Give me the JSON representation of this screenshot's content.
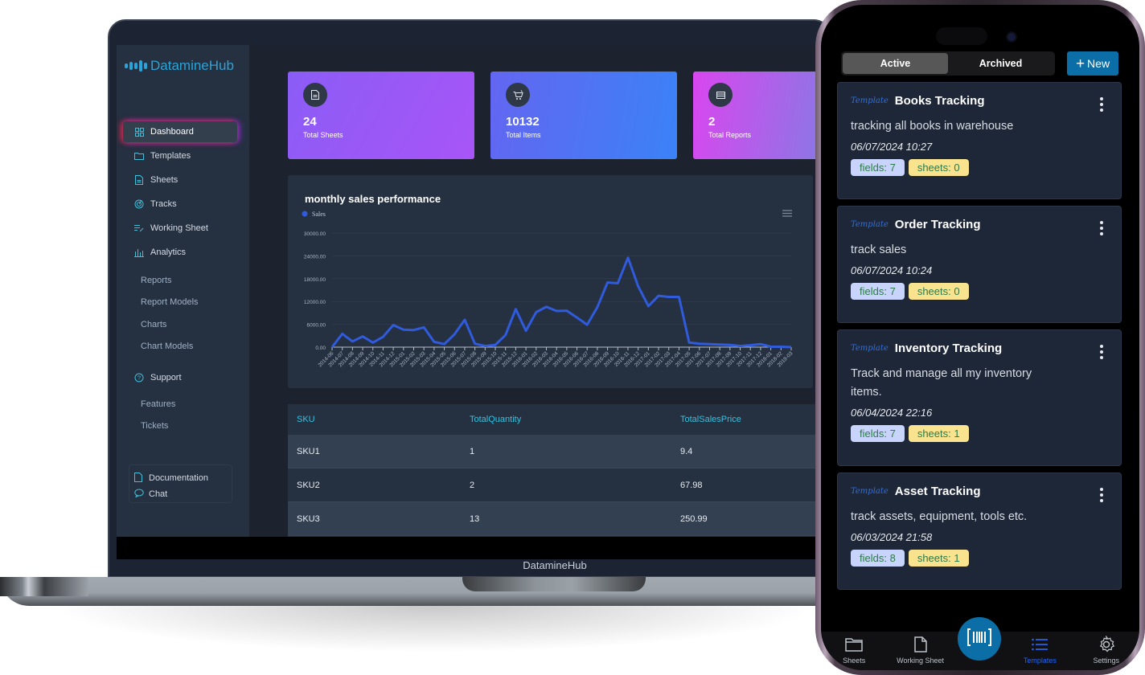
{
  "laptop": {
    "brand_label": "DatamineHub",
    "sidebar": {
      "logo_text": "DatamineHub",
      "nav": [
        {
          "label": "Dashboard",
          "icon": "grid-icon",
          "active": true
        },
        {
          "label": "Templates",
          "icon": "folder-icon"
        },
        {
          "label": "Sheets",
          "icon": "file-icon"
        },
        {
          "label": "Tracks",
          "icon": "radar-icon"
        },
        {
          "label": "Working Sheet",
          "icon": "list-edit-icon"
        },
        {
          "label": "Analytics",
          "icon": "bar-chart-icon"
        }
      ],
      "analytics_sub": [
        "Reports",
        "Report Models",
        "Charts",
        "Chart Models"
      ],
      "support": {
        "label": "Support",
        "icon": "help-circle-icon"
      },
      "support_sub": [
        "Features",
        "Tickets"
      ],
      "footer": [
        {
          "label": "Documentation",
          "icon": "document-icon"
        },
        {
          "label": "Chat",
          "icon": "chat-icon"
        }
      ]
    },
    "stats": [
      {
        "value": "24",
        "label": "Total Sheets",
        "icon": "file-icon"
      },
      {
        "value": "10132",
        "label": "Total Items",
        "icon": "cart-icon"
      },
      {
        "value": "2",
        "label": "Total Reports",
        "icon": "table-icon"
      }
    ],
    "table": {
      "columns": [
        "SKU",
        "TotalQuantity",
        "TotalSalesPrice"
      ],
      "rows": [
        [
          "SKU1",
          "1",
          "9.4"
        ],
        [
          "SKU2",
          "2",
          "67.98"
        ],
        [
          "SKU3",
          "13",
          "250.99"
        ]
      ]
    }
  },
  "chart_data": {
    "type": "line",
    "title": "monthly sales performance",
    "legend": [
      "Sales"
    ],
    "legend_position": "top-left",
    "xlabel": "",
    "ylabel": "",
    "ylim": [
      0,
      30000
    ],
    "yticks": [
      "0.00",
      "6000.00",
      "12000.00",
      "18000.00",
      "24000.00",
      "30000.00"
    ],
    "grid": true,
    "color": "#2f5bdc",
    "categories": [
      "2014-06",
      "2014-07",
      "2014-08",
      "2014-09",
      "2014-10",
      "2014-11",
      "2014-12",
      "2015-01",
      "2015-02",
      "2015-03",
      "2015-04",
      "2015-05",
      "2015-06",
      "2015-07",
      "2015-08",
      "2015-09",
      "2015-10",
      "2015-11",
      "2015-12",
      "2016-01",
      "2016-02",
      "2016-03",
      "2016-04",
      "2016-05",
      "2016-06",
      "2016-07",
      "2016-08",
      "2016-09",
      "2016-10",
      "2016-11",
      "2016-12",
      "2017-01",
      "2017-02",
      "2017-03",
      "2017-04",
      "2017-05",
      "2017-06",
      "2017-07",
      "2017-08",
      "2017-09",
      "2017-10",
      "2017-11",
      "2017-12",
      "2018-01",
      "2018-02",
      "2018-03"
    ],
    "series": [
      {
        "name": "Sales",
        "values": [
          0,
          3500,
          1500,
          2800,
          1200,
          2700,
          5800,
          4600,
          4500,
          5200,
          1400,
          800,
          3400,
          7200,
          900,
          300,
          600,
          3200,
          10000,
          4300,
          9200,
          10600,
          9500,
          9600,
          7800,
          5900,
          10500,
          17000,
          16800,
          23500,
          16000,
          10800,
          13500,
          13200,
          13200,
          1200,
          900,
          800,
          700,
          600,
          300,
          500,
          800,
          100,
          100,
          0
        ]
      }
    ]
  },
  "phone": {
    "segments": [
      {
        "label": "Active",
        "active": true
      },
      {
        "label": "Archived",
        "active": false
      }
    ],
    "new_button": "New",
    "template_tag": "Template",
    "templates": [
      {
        "title": "Books Tracking",
        "desc": "tracking all books in warehouse",
        "date": "06/07/2024 10:27",
        "fields": "fields: 7",
        "sheets": "sheets: 0"
      },
      {
        "title": "Order Tracking",
        "desc": "track sales",
        "date": "06/07/2024 10:24",
        "fields": "fields: 7",
        "sheets": "sheets: 0"
      },
      {
        "title": "Inventory Tracking",
        "desc": "Track and manage all my inventory items.",
        "date": "06/04/2024 22:16",
        "fields": "fields: 7",
        "sheets": "sheets: 1"
      },
      {
        "title": "Asset Tracking",
        "desc": "track assets, equipment, tools etc.",
        "date": "06/03/2024 21:58",
        "fields": "fields: 8",
        "sheets": "sheets: 1"
      }
    ],
    "bottom_nav": [
      {
        "label": "Sheets",
        "icon": "folder-icon"
      },
      {
        "label": "Working Sheet",
        "icon": "file-icon"
      },
      {
        "label": "Templates",
        "icon": "list-icon",
        "active": true
      },
      {
        "label": "Settings",
        "icon": "gear-icon"
      }
    ],
    "fab_icon": "barcode-scan-icon"
  }
}
